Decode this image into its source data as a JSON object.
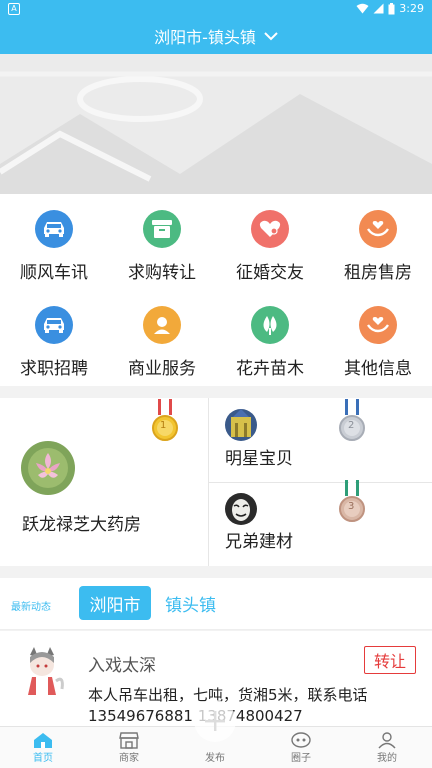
{
  "status_bar": {
    "time": "3:29",
    "notif_glyph": "A"
  },
  "header": {
    "city_title": "浏阳市-镇头镇"
  },
  "categories": [
    {
      "label": "顺风车讯",
      "icon": "car-icon",
      "color": "#3a8fe0"
    },
    {
      "label": "求购转让",
      "icon": "box-icon",
      "color": "#4cba82"
    },
    {
      "label": "征婚交友",
      "icon": "heart-icon",
      "color": "#f0716a"
    },
    {
      "label": "租房售房",
      "icon": "hand-heart-icon",
      "color": "#f28a52"
    },
    {
      "label": "求职招聘",
      "icon": "car-icon",
      "color": "#3a8fe0"
    },
    {
      "label": "商业服务",
      "icon": "person-icon",
      "color": "#f2a93a"
    },
    {
      "label": "花卉苗木",
      "icon": "tree-icon",
      "color": "#4cba82"
    },
    {
      "label": "其他信息",
      "icon": "hand-heart-icon",
      "color": "#f28a52"
    }
  ],
  "ranking": {
    "first": {
      "name": "跃龙禄芝大药房",
      "medal": "1"
    },
    "second": {
      "name": "明星宝贝",
      "medal": "2"
    },
    "third": {
      "name": "兄弟建材",
      "medal": "3"
    }
  },
  "feed_tabs": {
    "tag": "最新动态",
    "tab_city": "浏阳市",
    "tab_town": "镇头镇"
  },
  "post": {
    "author": "入戏太深",
    "category_badge": "转让",
    "line1": "本人吊车出租，七吨，货湘5米，联系电话",
    "line2": "13549676881 13874800427"
  },
  "bottom_nav": [
    {
      "label": "首页",
      "icon": "home-icon"
    },
    {
      "label": "商家",
      "icon": "shop-icon"
    },
    {
      "label": "发布",
      "icon": "plus-icon"
    },
    {
      "label": "圈子",
      "icon": "circle-icon"
    },
    {
      "label": "我的",
      "icon": "user-icon"
    }
  ]
}
